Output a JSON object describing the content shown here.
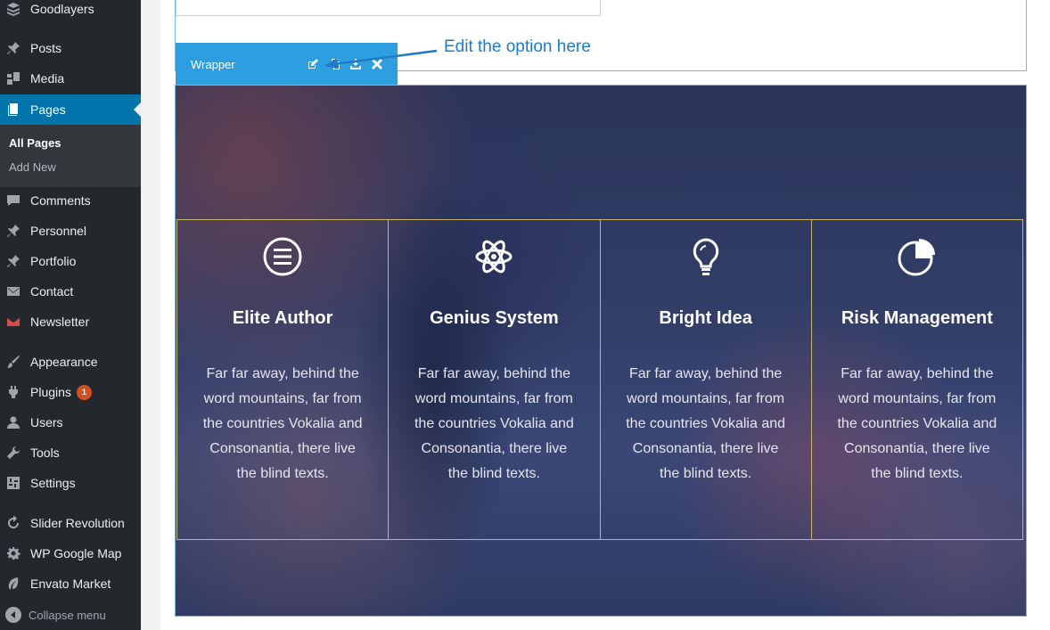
{
  "sidebar": {
    "items": [
      {
        "label": "Goodlayers",
        "icon": "goodlayers-icon"
      },
      {
        "label": "Posts",
        "icon": "pin-icon"
      },
      {
        "label": "Media",
        "icon": "media-icon"
      },
      {
        "label": "Pages",
        "icon": "pages-icon"
      },
      {
        "label": "Comments",
        "icon": "comment-icon"
      },
      {
        "label": "Personnel",
        "icon": "pin-icon"
      },
      {
        "label": "Portfolio",
        "icon": "pin-icon"
      },
      {
        "label": "Contact",
        "icon": "mail-icon"
      },
      {
        "label": "Newsletter",
        "icon": "newsletter-icon"
      },
      {
        "label": "Appearance",
        "icon": "brush-icon"
      },
      {
        "label": "Plugins",
        "icon": "plugin-icon",
        "badge": "1"
      },
      {
        "label": "Users",
        "icon": "user-icon"
      },
      {
        "label": "Tools",
        "icon": "wrench-icon"
      },
      {
        "label": "Settings",
        "icon": "settings-icon"
      },
      {
        "label": "Slider Revolution",
        "icon": "refresh-icon"
      },
      {
        "label": "WP Google Map",
        "icon": "gear-icon"
      },
      {
        "label": "Envato Market",
        "icon": "leaf-icon"
      }
    ],
    "submenu": {
      "all_pages": "All Pages",
      "add_new": "Add New"
    },
    "collapse": "Collapse menu"
  },
  "wrapper": {
    "label": "Wrapper",
    "icons": [
      "edit-icon",
      "duplicate-icon",
      "save-icon",
      "close-icon"
    ]
  },
  "annotation": "Edit the option here",
  "features": [
    {
      "icon": "menu-circle-icon",
      "title": "Elite Author",
      "text": "Far far away, behind the word mountains, far from the countries Vokalia and Consonantia, there live the blind texts."
    },
    {
      "icon": "atom-icon",
      "title": "Genius System",
      "text": "Far far away, behind the word mountains, far from the countries Vokalia and Consonantia, there live the blind texts."
    },
    {
      "icon": "lightbulb-icon",
      "title": "Bright Idea",
      "text": "Far far away, behind the word mountains, far from the countries Vokalia and Consonantia, there live the blind texts."
    },
    {
      "icon": "pie-chart-icon",
      "title": "Risk Management",
      "text": "Far far away, behind the word mountains, far from the countries Vokalia and Consonantia, there live the blind texts."
    }
  ],
  "colors": {
    "sidebar_bg": "#23282d",
    "active_bg": "#0073aa",
    "wrapper_bar": "#2d9fe0",
    "annotation": "#1f7bc6",
    "feature_border": "#c9b66b"
  }
}
